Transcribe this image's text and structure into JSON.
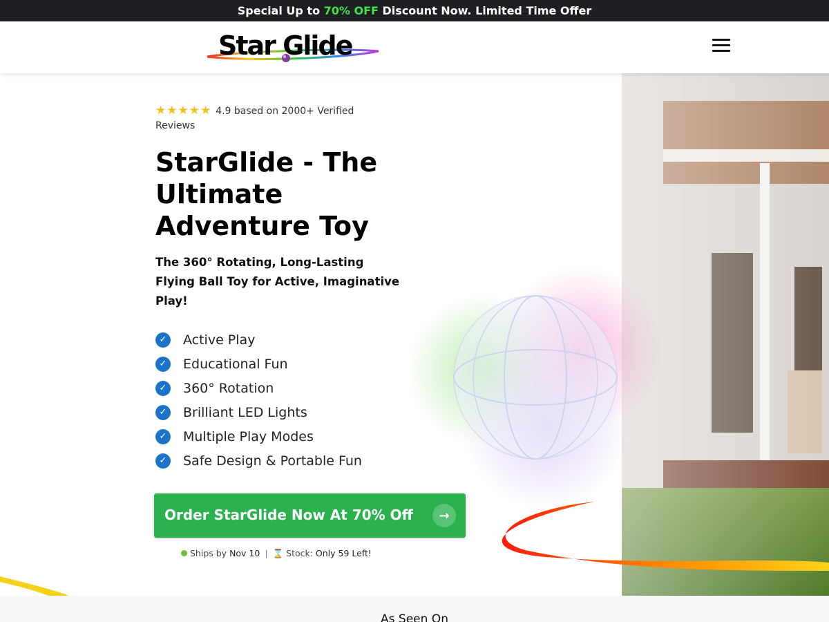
{
  "promo": {
    "prefix": "Special Up to ",
    "highlight": "70% OFF",
    "suffix": " Discount Now. Limited Time Offer"
  },
  "header": {
    "logo_text": "Star Glide",
    "menu_icon": "hamburger-menu-icon"
  },
  "hero": {
    "rating": {
      "stars": "★★★★★",
      "text": "4.9 based on 2000+ Verified Reviews"
    },
    "title": "StarGlide - The Ultimate Adventure Toy",
    "subtitle": "The 360° Rotating, Long-Lasting Flying Ball Toy for Active, Imaginative Play!",
    "features": [
      "Active Play",
      "Educational Fun",
      "360° Rotation",
      "Brilliant LED Lights",
      "Multiple Play Modes",
      "Safe Design & Portable Fun"
    ],
    "cta": {
      "label": "Order StarGlide Now At 70% Off",
      "arrow": "→"
    },
    "shipping": {
      "ships_prefix": "Ships by ",
      "ships_date": "Nov 10",
      "separator": "|",
      "stock_prefix": "Stock: ",
      "stock_value": "Only 59 Left!"
    }
  },
  "seen_on": {
    "title": "As Seen On"
  },
  "colors": {
    "promo_bg": "#1e1f23",
    "promo_accent": "#3ee34a",
    "check_blue": "#1b72c9",
    "cta_green": "#2ab24f",
    "star_yellow": "#f6c21a"
  }
}
